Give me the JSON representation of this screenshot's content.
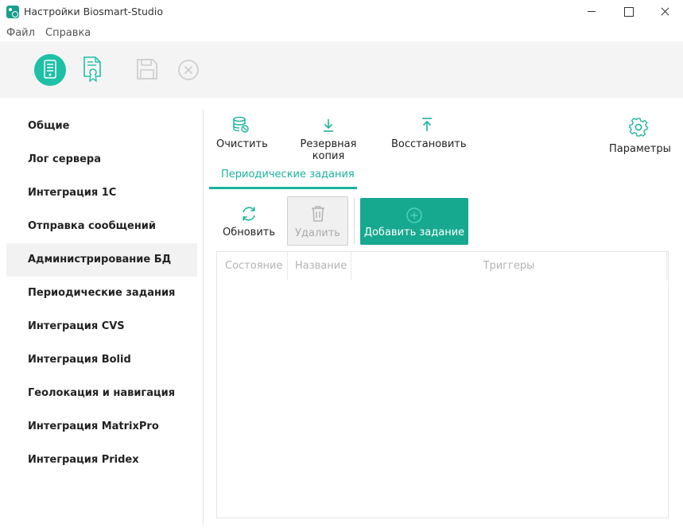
{
  "window": {
    "title": "Настройки Biosmart-Studio"
  },
  "menu": {
    "items": [
      {
        "label": "Файл"
      },
      {
        "label": "Справка"
      }
    ]
  },
  "toolbar": {
    "icons": [
      "server-icon",
      "certificate-icon",
      "save-icon",
      "cancel-icon"
    ],
    "accent": "#1ec0a6"
  },
  "sidebar": {
    "items": [
      {
        "label": "Общие"
      },
      {
        "label": "Лог сервера"
      },
      {
        "label": "Интеграция 1С"
      },
      {
        "label": "Отправка сообщений"
      },
      {
        "label": "Администрирование БД"
      },
      {
        "label": "Периодические задания"
      },
      {
        "label": "Интеграция CVS"
      },
      {
        "label": "Интеграция Bolid"
      },
      {
        "label": "Геолокация и навигация"
      },
      {
        "label": "Интеграция MatrixPro"
      },
      {
        "label": "Интеграция Pridex"
      }
    ],
    "active_label": "Администрирование БД"
  },
  "actions": {
    "clear": "Очистить",
    "backup": "Резервная копия",
    "restore": "Восстановить",
    "params": "Параметры"
  },
  "tabs": {
    "active": "Периодические задания"
  },
  "tasks": {
    "refresh": "Обновить",
    "delete": "Удалить",
    "add": "Добавить задание"
  },
  "table": {
    "columns": [
      "Состояние",
      "Название",
      "Триггеры"
    ]
  },
  "colors": {
    "accent": "#1ab39b",
    "add_button": "#16a98f"
  }
}
